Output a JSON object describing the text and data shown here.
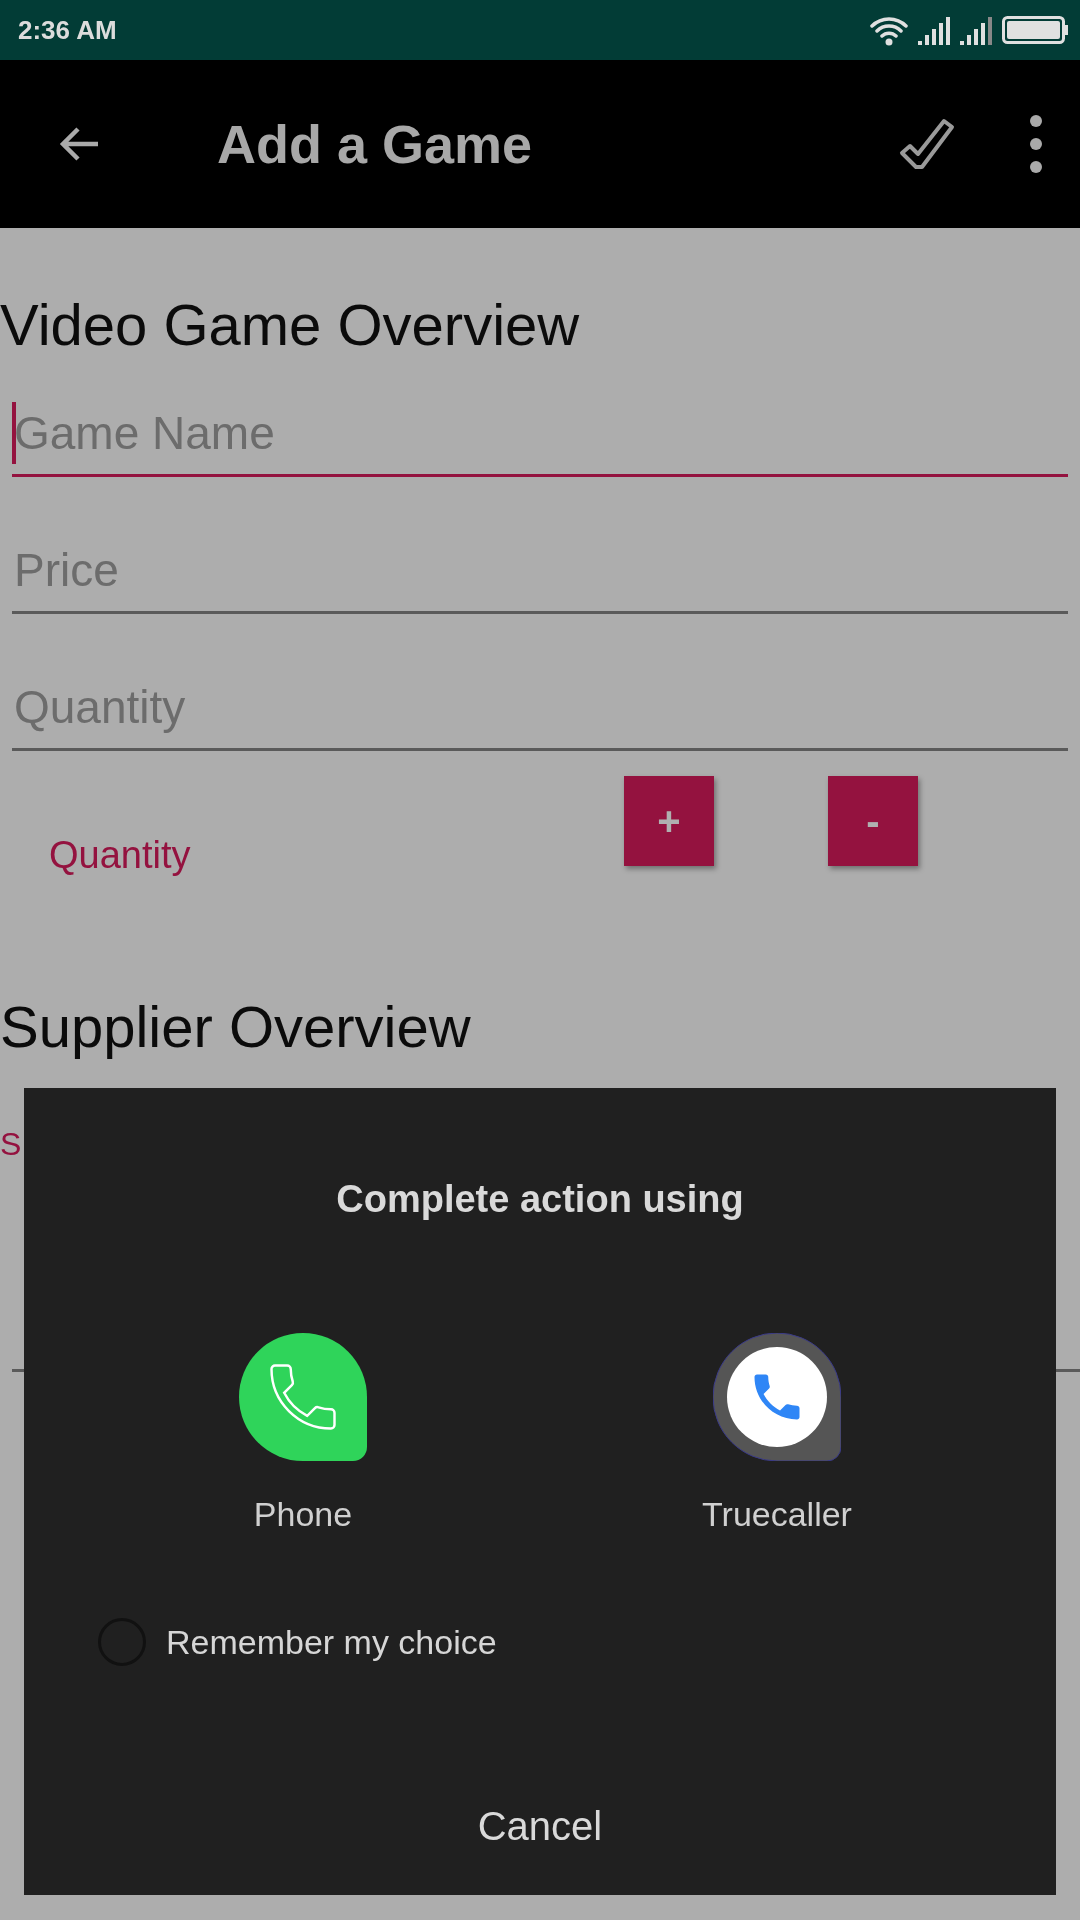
{
  "status_bar": {
    "time": "2:36 AM"
  },
  "toolbar": {
    "title": "Add a Game"
  },
  "game_overview": {
    "heading": "Video Game Overview",
    "fields": [
      {
        "placeholder": "Game Name",
        "focused": true
      },
      {
        "placeholder": "Price",
        "focused": false
      },
      {
        "placeholder": "Quantity",
        "focused": false
      }
    ],
    "quantity_label": "Quantity",
    "buttons": [
      "+",
      "-"
    ]
  },
  "supplier_overview": {
    "heading": "Supplier Overview",
    "label": "S"
  },
  "dialog": {
    "title": "Complete action using",
    "apps": [
      {
        "name": "Phone",
        "kind": "phone"
      },
      {
        "name": "Truecaller",
        "kind": "truecaller"
      }
    ],
    "remember": {
      "label": "Remember my choice",
      "checked": false
    },
    "cancel": "Cancel"
  }
}
